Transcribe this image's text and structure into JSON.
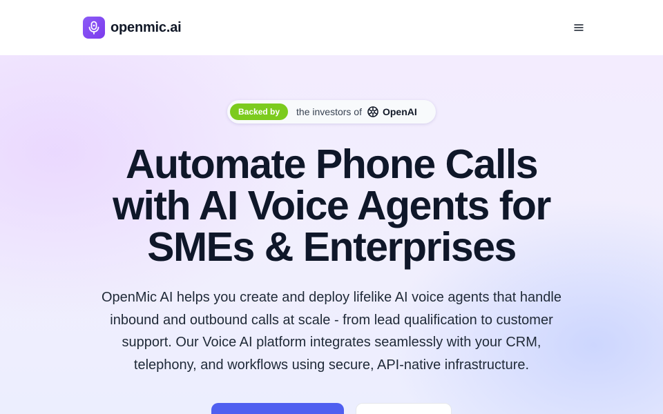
{
  "header": {
    "brand_name": "openmic.ai",
    "logo_icon": "microphone-icon",
    "menu_icon": "hamburger-menu-icon"
  },
  "hero": {
    "badge": {
      "pill_label": "Backed by",
      "text": "the investors of",
      "company_icon": "openai-logo-icon",
      "company": "OpenAI"
    },
    "headline_lines": [
      "Automate Phone Calls",
      "with AI Voice Agents for",
      "SMEs & Enterprises"
    ],
    "subtext_lines": [
      "OpenMic AI helps you create and deploy lifelike AI voice agents that handle",
      "inbound and outbound calls at scale - from lead qualification to customer",
      "support. Our Voice AI platform integrates seamlessly with your CRM,",
      "telephony, and workflows using secure, API-native infrastructure."
    ]
  },
  "colors": {
    "brand_purple": "#8b5cf6",
    "badge_green": "#7ccb1e",
    "primary_button": "#4f5ff0",
    "headline": "#0f1729"
  }
}
